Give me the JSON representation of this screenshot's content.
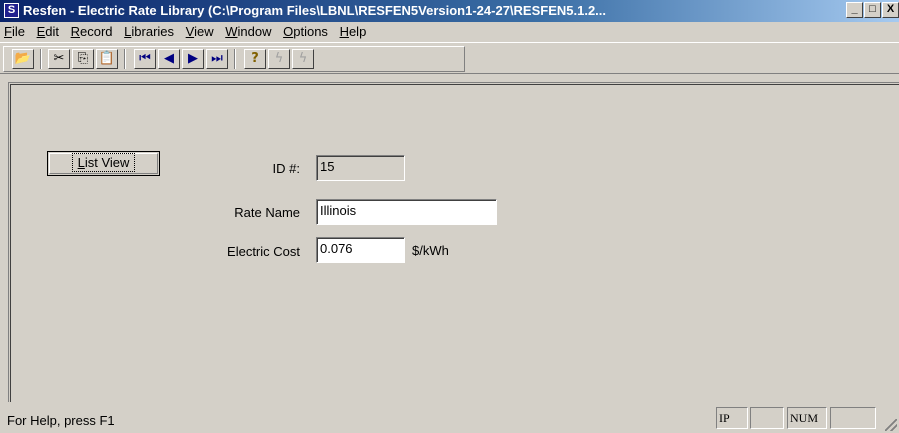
{
  "window": {
    "title": "Resfen - Electric Rate Library (C:\\Program Files\\LBNL\\RESFEN5Version1-24-27\\RESFEN5.1.2...",
    "icon_letter": "S",
    "buttons": {
      "minimize": "_",
      "maximize": "□",
      "close": "X"
    }
  },
  "menubar": {
    "items": [
      {
        "pre": "",
        "ul": "F",
        "post": "ile"
      },
      {
        "pre": "",
        "ul": "E",
        "post": "dit"
      },
      {
        "pre": "",
        "ul": "R",
        "post": "ecord"
      },
      {
        "pre": "",
        "ul": "L",
        "post": "ibraries"
      },
      {
        "pre": "",
        "ul": "V",
        "post": "iew"
      },
      {
        "pre": "",
        "ul": "W",
        "post": "indow"
      },
      {
        "pre": "",
        "ul": "O",
        "post": "ptions"
      },
      {
        "pre": "",
        "ul": "H",
        "post": "elp"
      }
    ]
  },
  "toolbar": {
    "open": "📂",
    "cut": "✂",
    "copy": "⎘",
    "paste": "📋",
    "first": "⏮",
    "prev": "◀",
    "next": "▶",
    "last": "⏭",
    "help": "?",
    "calc": "ϟ",
    "calc_all": "ϟ"
  },
  "form": {
    "list_view_button": {
      "ul": "L",
      "rest": "ist View"
    },
    "id_label": "ID #:",
    "id_value": "15",
    "rate_name_label": "Rate Name",
    "rate_name_value": "Illinois",
    "electric_cost_label": "Electric Cost",
    "electric_cost_value": "0.076",
    "electric_cost_unit": "$/kWh"
  },
  "statusbar": {
    "help_text": "For Help, press F1",
    "panes": [
      "IP",
      "",
      "NUM",
      ""
    ]
  }
}
